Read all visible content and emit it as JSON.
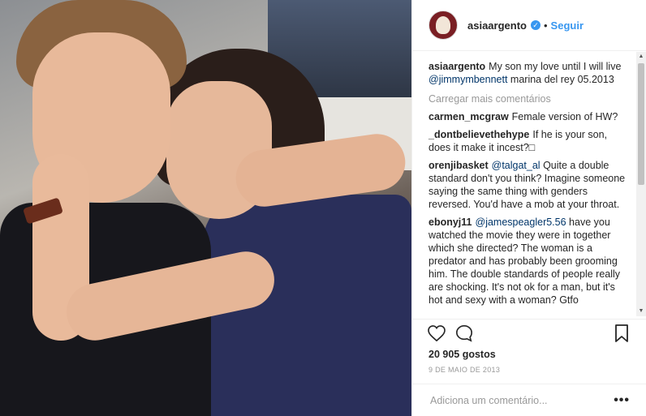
{
  "post": {
    "username": "asiaargento",
    "follow_label": "Seguir",
    "dot": "•",
    "verified_glyph": "✓",
    "caption": {
      "user": "asiaargento",
      "text_before": "My son my love until I will live ",
      "mention": "@jimmymbennett",
      "text_after": " marina del rey 05.2013"
    },
    "load_more": "Carregar mais comentários",
    "comments": [
      {
        "user": "carmen_mcgraw",
        "mention": "",
        "text": "Female version of HW?"
      },
      {
        "user": "_dontbelievethehype",
        "mention": "",
        "text": "If he is your son, does it make it incest?□"
      },
      {
        "user": "orenjibasket",
        "mention": "@talgat_al",
        "text": " Quite a double standard don't you think? Imagine someone saying the same thing with genders reversed. You'd have a mob at your throat."
      },
      {
        "user": "ebonyj11",
        "mention": "@jamespeagler5.56",
        "text": " have you watched the movie they were in together which she directed? The woman is a predator and has probably been grooming him. The double standards of people really are shocking. It's not ok for a man, but it's hot and sexy with a woman? Gtfo"
      }
    ],
    "likes": "20 905 gostos",
    "date": "9 DE MAIO DE 2013",
    "add_comment_placeholder": "Adiciona um comentário...",
    "more_glyph": "•••",
    "icons": {
      "like": "heart-icon",
      "comment": "comment-icon",
      "save": "bookmark-icon",
      "verified": "verified-badge-icon"
    },
    "colors": {
      "link": "#3897f0",
      "verified": "#3897f0",
      "muted": "#999999",
      "text": "#262626"
    }
  }
}
